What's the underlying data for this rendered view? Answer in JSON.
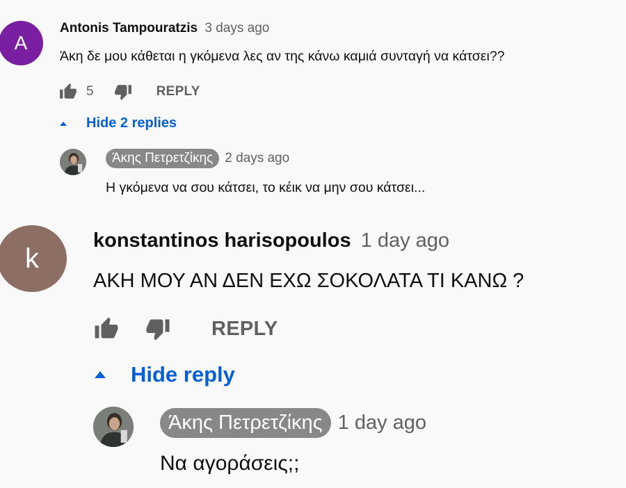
{
  "comments": [
    {
      "avatar_letter": "A",
      "avatar_color": "#7b1fa2",
      "author": "Antonis Tampouratzis",
      "time": "3 days ago",
      "text": "Άκη δε μου κάθεται η γκόμενα λες αν της κάνω καμιά συνταγή να κάτσει??",
      "likes": "5",
      "reply_label": "REPLY",
      "toggle_label": "Hide 2 replies",
      "reply": {
        "author": "Άκης Πετρετζίκης",
        "time": "2 days ago",
        "text": "Η γκόμενα να σου κάτσει, το κέικ να μην σου κάτσει..."
      }
    },
    {
      "avatar_letter": "k",
      "avatar_color": "#8d6e63",
      "author": "konstantinos harisopoulos",
      "time": "1 day ago",
      "text": "ΑΚΗ ΜΟΥ ΑΝ ΔΕΝ ΕΧΩ ΣΟΚΟΛΑΤΑ ΤΙ ΚΑΝΩ ?",
      "reply_label": "REPLY",
      "toggle_label": "Hide reply",
      "reply": {
        "author": "Άκης Πετρετζίκης",
        "time": "1 day ago",
        "text": "Να αγοράσεις;;"
      }
    }
  ],
  "icons": {
    "like": "thumbs-up-icon",
    "dislike": "thumbs-down-icon",
    "toggle": "caret-up-icon"
  },
  "colors": {
    "link": "#065fd4",
    "secondary_text": "#606060",
    "creator_badge": "#888888"
  }
}
